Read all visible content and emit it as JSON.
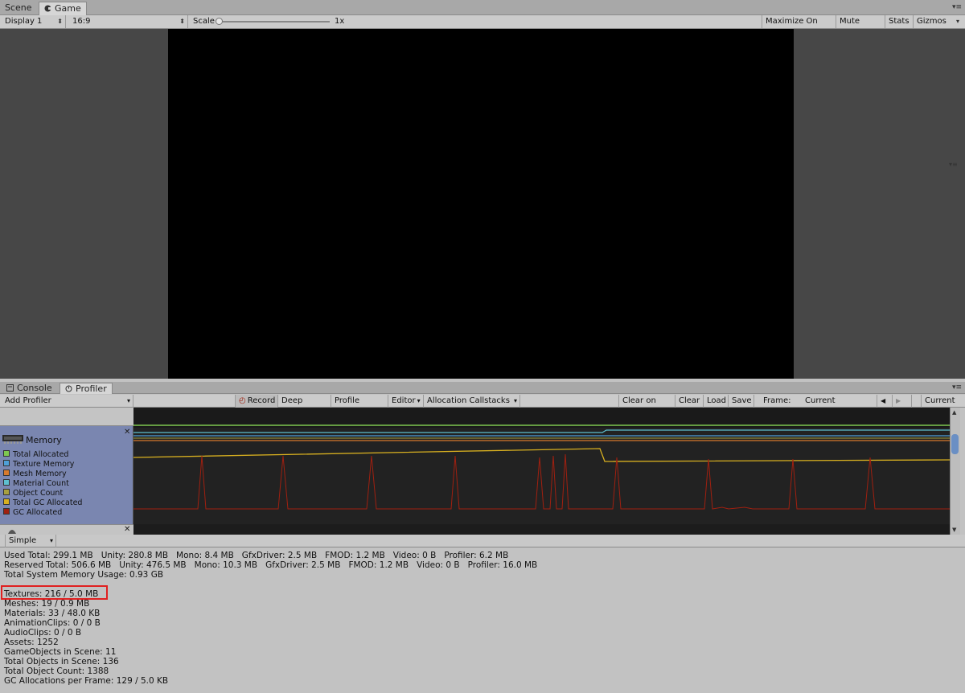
{
  "top_tabs": [
    {
      "label": "Scene",
      "active": false
    },
    {
      "label": "Game",
      "active": true
    }
  ],
  "game_toolbar": {
    "display": "Display 1",
    "aspect": "16:9",
    "scale_label": "Scale",
    "scale_value": "1x",
    "buttons": [
      "Maximize On Play",
      "Mute Audio",
      "Stats",
      "Gizmos"
    ]
  },
  "bottom_tabs": [
    {
      "label": "Console",
      "active": false
    },
    {
      "label": "Profiler",
      "active": true
    }
  ],
  "profiler_toolbar": {
    "add_profiler": "Add Profiler",
    "record": "Record",
    "deep_profile": "Deep Profile",
    "profile_editor": "Profile Editor",
    "editor": "Editor",
    "allocation_callstacks": "Allocation Callstacks",
    "clear_on_play": "Clear on Play",
    "clear": "Clear",
    "load": "Load",
    "save": "Save",
    "frame_label": "Frame:",
    "frame_value": "Current",
    "current": "Current"
  },
  "memory_panel": {
    "title": "Memory",
    "legend": [
      {
        "label": "Total Allocated",
        "color": "#7ec850"
      },
      {
        "label": "Texture Memory",
        "color": "#4fa0d8"
      },
      {
        "label": "Mesh Memory",
        "color": "#d87a2c"
      },
      {
        "label": "Material Count",
        "color": "#5ec0d0"
      },
      {
        "label": "Object Count",
        "color": "#a8a040"
      },
      {
        "label": "Total GC Allocated",
        "color": "#d8b020"
      },
      {
        "label": "GC Allocated",
        "color": "#a02010"
      }
    ]
  },
  "view_mode": "Simple",
  "details": [
    "Used Total: 299.1 MB   Unity: 280.8 MB   Mono: 8.4 MB   GfxDriver: 2.5 MB   FMOD: 1.2 MB   Video: 0 B   Profiler: 6.2 MB",
    "Reserved Total: 506.6 MB   Unity: 476.5 MB   Mono: 10.3 MB   GfxDriver: 2.5 MB   FMOD: 1.2 MB   Video: 0 B   Profiler: 16.0 MB",
    "Total System Memory Usage: 0.93 GB",
    "",
    "Textures: 216 / 5.0 MB",
    "Meshes: 19 / 0.9 MB",
    "Materials: 33 / 48.0 KB",
    "AnimationClips: 0 / 0 B",
    "AudioClips: 0 / 0 B",
    "Assets: 1252",
    "GameObjects in Scene: 11",
    "Total Objects in Scene: 136",
    "Total Object Count: 1388",
    "GC Allocations per Frame: 129 / 5.0 KB"
  ]
}
